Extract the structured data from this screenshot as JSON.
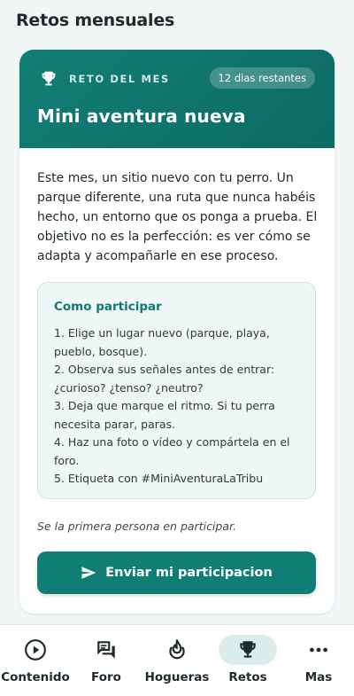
{
  "header": {
    "title": "Retos mensuales"
  },
  "challenge": {
    "tag": "RETO DEL MES",
    "days_remaining": "12 dias restantes",
    "title": "Mini aventura nueva",
    "intro": "Este mes, un sitio nuevo con tu perro. Un parque diferente, una ruta que nunca habéis hecho, un entorno que os ponga a prueba. El objetivo no es la perfección: es ver cómo se adapta y acompañarle en ese proceso.",
    "how_to": {
      "title": "Como participar",
      "steps": [
        "1. Elige un lugar nuevo (parque, playa, pueblo, bosque).",
        "2. Observa sus señales antes de entrar: ¿curioso? ¿tenso? ¿neutro?",
        "3. Deja que marque el ritmo. Si tu perra necesita parar, paras.",
        "4. Haz una foto o vídeo y compártela en el foro.",
        "5. Etiqueta con #MiniAventuraLaTribu"
      ]
    },
    "footnote": "Se la primera persona en participar.",
    "cta_label": "Enviar mi participacion"
  },
  "nav": {
    "items": [
      {
        "label": "Contenido",
        "icon": "play-circle-icon",
        "active": false
      },
      {
        "label": "Foro",
        "icon": "chat-bubbles-icon",
        "active": false
      },
      {
        "label": "Hogueras",
        "icon": "flame-icon",
        "active": false
      },
      {
        "label": "Retos",
        "icon": "trophy-icon",
        "active": true
      },
      {
        "label": "Mas",
        "icon": "more-dots-icon",
        "active": false
      }
    ]
  },
  "colors": {
    "brand": "#117e76",
    "background": "#f1f7f6",
    "steps_background": "#eef7f5",
    "active_nav_pill": "#dcecea"
  }
}
